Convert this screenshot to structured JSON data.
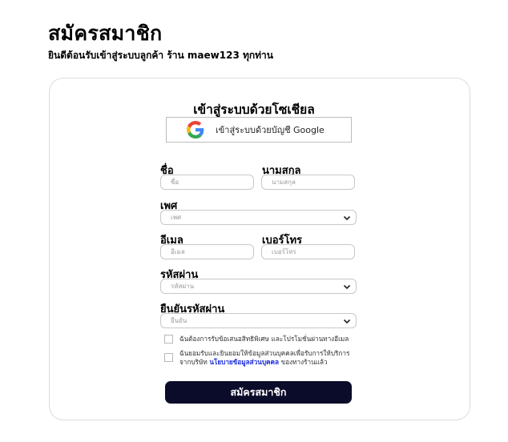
{
  "header": {
    "title": "สมัครสมาชิก",
    "subtitle": "ยินดีต้อนรับเข้าสู่ระบบลูกค้า ร้าน maew123 ทุกท่าน"
  },
  "social": {
    "title": "เข้าสู่ระบบด้วยโซเชียล",
    "google_label": "เข้าสู่ระบบด้วยบัญชี Google"
  },
  "form": {
    "first_name": {
      "label": "ชื่อ",
      "placeholder": "ชื่อ"
    },
    "last_name": {
      "label": "นามสกุล",
      "placeholder": "นามสกุล"
    },
    "gender": {
      "label": "เพศ",
      "placeholder": "เพศ"
    },
    "email": {
      "label": "อีเมล",
      "placeholder": "อีเมล"
    },
    "phone": {
      "label": "เบอร์โทร",
      "placeholder": "เบอร์โทร"
    },
    "password": {
      "label": "รหัสผ่าน",
      "placeholder": "รหัสผ่าน"
    },
    "confirm_password": {
      "label": "ยืนยันรหัสผ่าน",
      "placeholder": "ยืนยัน"
    }
  },
  "consent": {
    "promo_text": "ฉันต้องการรับข้อเสนอสิทธิพิเศษ และโปรโมชั่นผ่านทางอีเมล",
    "privacy_line1": "ฉันยอมรับและยินยอมให้ข้อมูลส่วนบุคคลเพื่อรับการให้บริการ",
    "privacy_line2_prefix": "จากบริษัท ",
    "privacy_link": "นโยบายข้อมูลส่วนบุคคล",
    "privacy_line2_suffix": " ของทางร้านแล้ว"
  },
  "submit_label": "สมัครสมาชิก",
  "colors": {
    "primary": "#0b0b2a",
    "link": "#1a2ad8",
    "border": "#c8c8c8"
  },
  "icons": {
    "google": "google-icon",
    "select": "chevron-down-icon"
  }
}
